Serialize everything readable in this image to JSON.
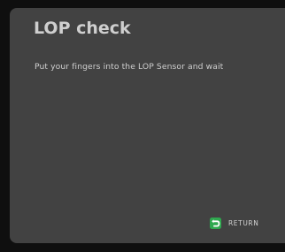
{
  "screen": {
    "title": "LOP check",
    "instruction": "Put your fingers into the LOP Sensor and wait"
  },
  "footer": {
    "return_label": "RETURN",
    "return_icon": "back-arrow-icon",
    "return_icon_color": "#2fa84f"
  },
  "colors": {
    "frame": "#0f0f0f",
    "panel": "#424242",
    "text": "#cfcfcf"
  }
}
